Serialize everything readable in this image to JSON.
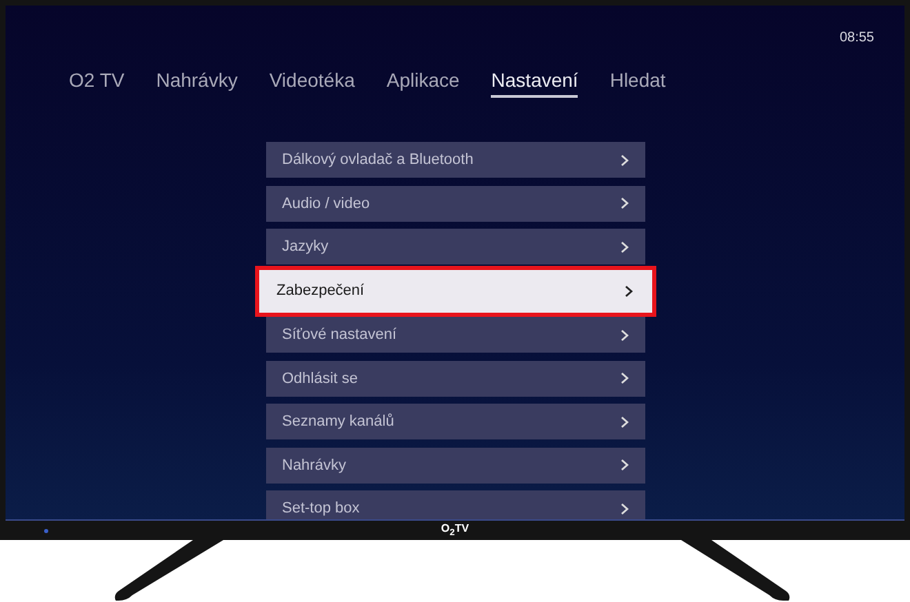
{
  "clock": "08:55",
  "nav": [
    {
      "label": "O2 TV",
      "selected": false
    },
    {
      "label": "Nahrávky",
      "selected": false
    },
    {
      "label": "Videotéka",
      "selected": false
    },
    {
      "label": "Aplikace",
      "selected": false
    },
    {
      "label": "Nastavení",
      "selected": true
    },
    {
      "label": "Hledat",
      "selected": false
    }
  ],
  "settings_menu": [
    {
      "label": "Dálkový ovladač a Bluetooth",
      "selected": false
    },
    {
      "label": "Audio / video",
      "selected": false
    },
    {
      "label": "Jazyky",
      "selected": false
    },
    {
      "label": "Zabezpečení",
      "selected": true
    },
    {
      "label": "Síťové nastavení",
      "selected": false
    },
    {
      "label": "Odhlásit se",
      "selected": false
    },
    {
      "label": "Seznamy kanálů",
      "selected": false
    },
    {
      "label": "Nahrávky",
      "selected": false
    },
    {
      "label": "Set-top box",
      "selected": false
    }
  ],
  "bezel_logo": "O$_{2}$TV"
}
